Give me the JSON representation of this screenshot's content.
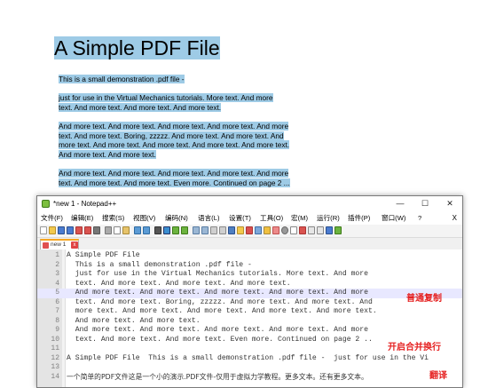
{
  "pdf": {
    "title": "A Simple PDF File",
    "lines": [
      "This is a small demonstration .pdf file -",
      "just for use in the Virtual Mechanics tutorials. More text. And more",
      "text. And more text. And more text. And more text.",
      "And more text. And more text. And more text. And more text. And more",
      "text. And more text. Boring, zzzzz. And more text. And more text. And",
      "more text. And more text. And more text. And more text. And more text.",
      "And more text. And more text.",
      "And more text. And more text. And more text. And more text. And more",
      "text. And more text. And more text. Even more. Continued on page 2 ..."
    ]
  },
  "window": {
    "title": "*new 1 - Notepad++",
    "minimize": "—",
    "maximize": "☐",
    "close": "✕"
  },
  "menu": [
    "文件(F)",
    "编辑(E)",
    "搜索(S)",
    "视图(V)",
    "编码(N)",
    "语言(L)",
    "设置(T)",
    "工具(O)",
    "宏(M)",
    "运行(R)",
    "插件(P)",
    "窗口(W)",
    "?"
  ],
  "menu_close": "X",
  "tab": {
    "label": "new 1",
    "close": "x"
  },
  "editor": {
    "current_line": 5,
    "lines": [
      "A Simple PDF File",
      "  This is a small demonstration .pdf file -",
      "  just for use in the Virtual Mechanics tutorials. More text. And more",
      "  text. And more text. And more text. And more text.",
      "  And more text. And more text. And more text. And more text. And more",
      "  text. And more text. Boring, zzzzz. And more text. And more text. And",
      "  more text. And more text. And more text. And more text. And more text.",
      "  And more text. And more text.",
      "  And more text. And more text. And more text. And more text. And more",
      "  text. And more text. And more text. Even more. Continued on page 2 ..",
      "",
      "A Simple PDF File  This is a small demonstration .pdf file -  just for use in the Vi",
      "",
      "一个简单的PDF文件这是一个小的演示.PDF文件-仅用于虚拟力学教程。更多文本。还有更多文本。"
    ],
    "line_numbers": [
      "1",
      "2",
      "3",
      "4",
      "5",
      "6",
      "7",
      "8",
      "9",
      "10",
      "11",
      "12",
      "13",
      "14"
    ]
  },
  "annotations": {
    "normal_copy": "普通复制",
    "merge_lines": "开启合并换行",
    "translate": "翻译"
  },
  "colors": {
    "selection": "#9ecbe6",
    "annotation": "#e52020",
    "current_line": "#e8e8ff"
  }
}
